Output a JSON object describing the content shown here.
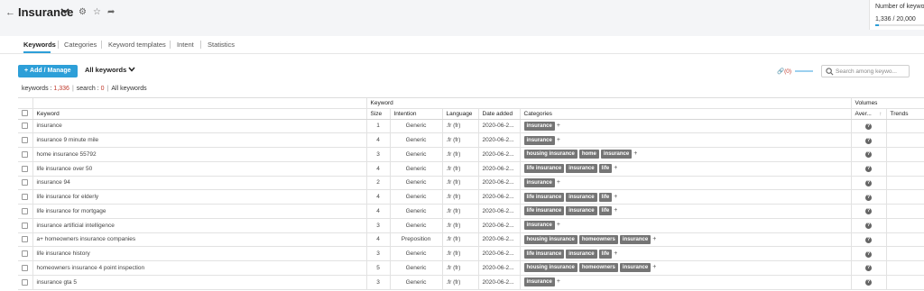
{
  "header": {
    "title": "Insurance"
  },
  "kw_limit": {
    "label": "Number of keywords",
    "value": "1,336 / 20,000",
    "fill_fraction": 0.067
  },
  "tabs": [
    {
      "label": "Keywords",
      "active": true
    },
    {
      "label": "Categories"
    },
    {
      "label": "Keyword templates"
    },
    {
      "label": "Intent"
    },
    {
      "label": "Statistics"
    }
  ],
  "toolbar": {
    "add_label": "Add / Manage",
    "filter_label": "All keywords",
    "links_count": "(0)"
  },
  "search": {
    "placeholder": "Search among keywo..."
  },
  "stats": {
    "keywords_label": "keywords :",
    "keywords_value": "1,336",
    "search_label": "search :",
    "search_value": "0",
    "all_label": "All keywords"
  },
  "table": {
    "group_keyword": "Keyword",
    "group_volumes": "Volumes",
    "col_keyword": "Keyword",
    "col_size": "Size",
    "col_intention": "Intention",
    "col_language": "Language",
    "col_date": "Date added",
    "col_categories": "Categories",
    "col_average": "Aver...",
    "col_trends": "Trends",
    "rows": [
      {
        "keyword": "insurance",
        "size": "1",
        "intention": "Generic",
        "language": ".fr (fr)",
        "date": "2020-06-2...",
        "categories": [
          "insurance"
        ]
      },
      {
        "keyword": "insurance 9 minute mile",
        "size": "4",
        "intention": "Generic",
        "language": ".fr (fr)",
        "date": "2020-06-2...",
        "categories": [
          "insurance"
        ]
      },
      {
        "keyword": "home insurance 55792",
        "size": "3",
        "intention": "Generic",
        "language": ".fr (fr)",
        "date": "2020-06-2...",
        "categories": [
          "housing insurance",
          "home",
          "insurance"
        ]
      },
      {
        "keyword": "life insurance over 50",
        "size": "4",
        "intention": "Generic",
        "language": ".fr (fr)",
        "date": "2020-06-2...",
        "categories": [
          "life insurance",
          "insurance",
          "life"
        ]
      },
      {
        "keyword": "insurance 94",
        "size": "2",
        "intention": "Generic",
        "language": ".fr (fr)",
        "date": "2020-06-2...",
        "categories": [
          "insurance"
        ]
      },
      {
        "keyword": "life insurance for elderly",
        "size": "4",
        "intention": "Generic",
        "language": ".fr (fr)",
        "date": "2020-06-2...",
        "categories": [
          "life insurance",
          "insurance",
          "life"
        ]
      },
      {
        "keyword": "life insurance for mortgage",
        "size": "4",
        "intention": "Generic",
        "language": ".fr (fr)",
        "date": "2020-06-2...",
        "categories": [
          "life insurance",
          "insurance",
          "life"
        ]
      },
      {
        "keyword": "insurance artificial intelligence",
        "size": "3",
        "intention": "Generic",
        "language": ".fr (fr)",
        "date": "2020-06-2...",
        "categories": [
          "insurance"
        ]
      },
      {
        "keyword": "a+ homeowners insurance companies",
        "size": "4",
        "intention": "Preposition",
        "language": ".fr (fr)",
        "date": "2020-06-2...",
        "categories": [
          "housing insurance",
          "homeowners",
          "insurance"
        ]
      },
      {
        "keyword": "life insurance history",
        "size": "3",
        "intention": "Generic",
        "language": ".fr (fr)",
        "date": "2020-06-2...",
        "categories": [
          "life insurance",
          "insurance",
          "life"
        ]
      },
      {
        "keyword": "homeowners insurance 4 point inspection",
        "size": "5",
        "intention": "Generic",
        "language": ".fr (fr)",
        "date": "2020-06-2...",
        "categories": [
          "housing insurance",
          "homeowners",
          "insurance"
        ]
      },
      {
        "keyword": "insurance gta 5",
        "size": "3",
        "intention": "Generic",
        "language": ".fr (fr)",
        "date": "2020-06-2...",
        "categories": [
          "insurance"
        ]
      }
    ]
  },
  "colors": {
    "accent": "#2d9fd8",
    "tag": "#757575",
    "alert": "#c0392b"
  }
}
